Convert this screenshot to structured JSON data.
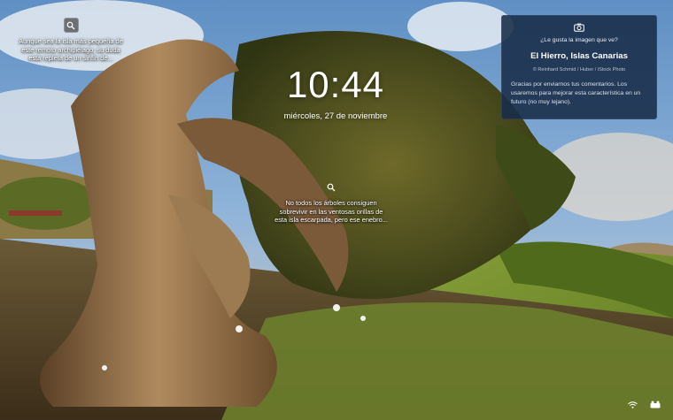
{
  "lockscreen": {
    "time": "10:44",
    "date": "miércoles, 27 de noviembre"
  },
  "hotspots": [
    {
      "icon": "search-icon",
      "text": "Aunque sea la isla más pequeña de este remoto archipiélago, su duda está repleta de un sinfín de..."
    },
    {
      "icon": "search-icon",
      "text": "No todos los árboles consiguen sobrevivir en las ventosas orillas de esta isla escarpada, pero ese enebro..."
    }
  ],
  "spotlight_card": {
    "icon": "camera-icon",
    "question": "¿Le gusta la imagen que ve?",
    "place": "El Hierro, Islas Canarias",
    "credit": "© Reinhard Schmid / Huber / iStock Photo",
    "feedback": "Gracias por enviarnos tus comentarios. Los usaremos para mejorar esta característica en un futuro (no muy lejano)."
  },
  "tray": {
    "icons": [
      "wifi-icon",
      "accessibility-icon"
    ]
  },
  "colors": {
    "card_bg": "#182c48",
    "sky": "#6f9ecf",
    "foliage": "#4f5a1e",
    "trunk": "#8a6a45",
    "grass": "#6f8a2c"
  }
}
